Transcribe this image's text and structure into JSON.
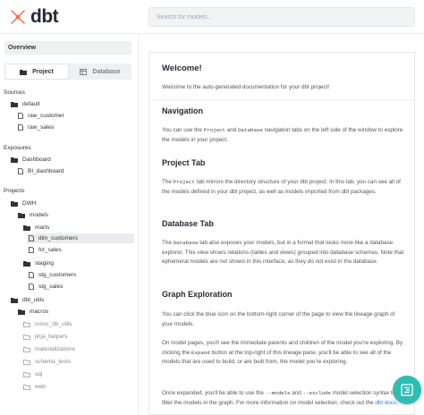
{
  "header": {
    "brand": "dbt",
    "search_placeholder": "Search for models..."
  },
  "sidebar": {
    "overview_label": "Overview",
    "tabs": [
      {
        "label": "Project",
        "icon": "folder-icon",
        "active": true
      },
      {
        "label": "Database",
        "icon": "table-icon",
        "active": false
      }
    ],
    "sources_title": "Sources",
    "sources": {
      "folder": "default",
      "items": [
        "raw_customer",
        "raw_sales"
      ]
    },
    "exposures_title": "Exposures",
    "exposures": {
      "folder": "Dashboard",
      "items": [
        "BI_dashboard"
      ]
    },
    "projects_title": "Projects",
    "projects": {
      "dwh": "DWH",
      "models": "models",
      "marts": "marts",
      "marts_items": [
        "dim_customers",
        "fct_sales"
      ],
      "staging": "staging",
      "staging_items": [
        "stg_customers",
        "stg_sales"
      ],
      "dbt_utils": "dbt_utils",
      "macros": "macros",
      "macro_folders": [
        "cross_db_utils",
        "jinja_helpers",
        "materializations",
        "schema_tests",
        "sql",
        "web"
      ]
    }
  },
  "content": {
    "welcome_title": "Welcome!",
    "welcome_text": "Welcome to the auto-generated documentation for your dbt project!",
    "nav_title": "Navigation",
    "nav_text": {
      "a": "You can use the ",
      "b": "Project",
      "c": " and ",
      "d": "Database",
      "e": " navigation tabs on the left side of the window to explore the models in your project."
    },
    "project_tab_title": "Project Tab",
    "project_tab_text": {
      "a": "The ",
      "b": "Project",
      "c": " tab mirrors the directory structure of your dbt project. In this tab, you can see all of the models defined in your dbt project, as well as models imported from dbt packages."
    },
    "database_tab_title": "Database Tab",
    "database_tab_text": {
      "a": "The ",
      "b": "Database",
      "c": " tab also exposes your models, but in a format that looks more like a database explorer. This view shows relations (tables and views) grouped into database schemas. Note that ephemeral models are not shown in this interface, as they do not exist in the database."
    },
    "graph_title": "Graph Exploration",
    "graph_text_1": "You can click the blue icon on the bottom-right corner of the page to view the lineage graph of your models.",
    "graph_text_2": {
      "a": "On model pages, you'll see the immediate parents and children of the model you're exploring. By clicking the ",
      "b": "Expand",
      "c": " button at the top-right of this lineage pane, you'll be able to see all of the models that are used to build, or are built from, the model you're exploring."
    },
    "graph_text_3": {
      "a": "Once expanded, you'll be able to use the ",
      "b": "--models",
      "c": " and ",
      "d": "--exclude",
      "e": " model selection syntax to filter the models in the graph. For more information on model selection, check out the ",
      "f": "dbt docs",
      "g": "."
    }
  },
  "colors": {
    "brand_orange": "#ff694b",
    "fab_teal": "#2ebdb5",
    "link_blue": "#2f7fd8"
  }
}
